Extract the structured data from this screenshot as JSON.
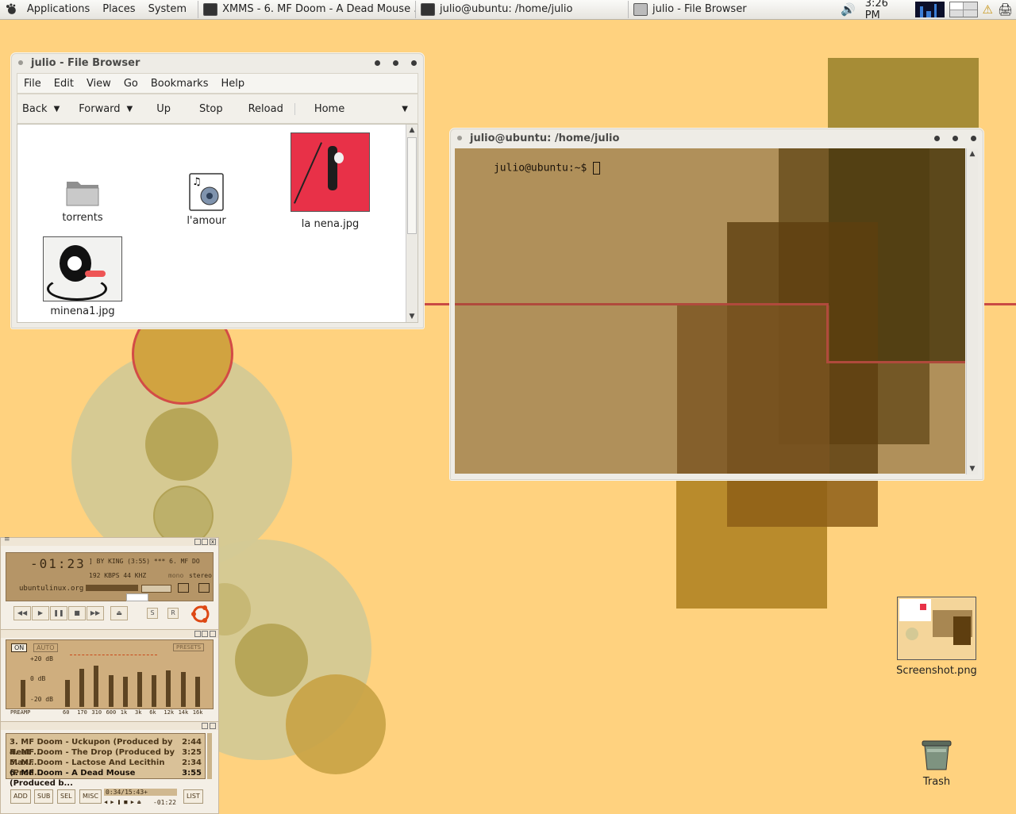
{
  "panel": {
    "menus": [
      "Applications",
      "Places",
      "System"
    ],
    "tasks": [
      {
        "label": "XMMS - 6. MF Doom - A Dead Mouse ..."
      },
      {
        "label": "julio@ubuntu: /home/julio"
      },
      {
        "label": "julio - File Browser"
      }
    ],
    "clock": "3:26 PM"
  },
  "file_browser": {
    "title": "julio - File Browser",
    "menus": [
      "File",
      "Edit",
      "View",
      "Go",
      "Bookmarks",
      "Help"
    ],
    "toolbar": {
      "back": "Back",
      "forward": "Forward",
      "up": "Up",
      "stop": "Stop",
      "reload": "Reload",
      "home": "Home"
    },
    "items": [
      {
        "name": "torrents",
        "icon": "folder-icon"
      },
      {
        "name": "l'amour",
        "icon": "audio-file-icon"
      },
      {
        "name": "la nena.jpg",
        "icon": "image-thumbnail"
      },
      {
        "name": "minena1.jpg",
        "icon": "image-thumbnail"
      }
    ]
  },
  "terminal": {
    "title": "julio@ubuntu: /home/julio",
    "prompt": "julio@ubuntu:~$ "
  },
  "xmms": {
    "time": "-01:23",
    "scroll_text": "] BY KING (3:55)  ***  6. MF DO",
    "bitrate": "192 KBPS 44 KHZ",
    "mono": "mono",
    "stereo": "stereo",
    "skin_text": "ubuntulinux.org",
    "eq": {
      "on": "ON",
      "auto": "AUTO",
      "presets": "PRESETS",
      "db_top": "+20 dB",
      "db_mid": "0 dB",
      "db_bottom": "-20 dB",
      "preamp": "PREAMP",
      "bands": [
        "60",
        "170",
        "310",
        "600",
        "1k",
        "3k",
        "6k",
        "12k",
        "14k",
        "16k"
      ]
    },
    "playlist": [
      {
        "title": "3. MF Doom - Uckupon (Produced by Heat ...",
        "time": "2:44"
      },
      {
        "title": "4. MF Doom - The Drop (Produced by Max...",
        "time": "3:25"
      },
      {
        "title": "5. MF Doom - Lactose And Lecithin (Prod...",
        "time": "2:34"
      },
      {
        "title": "6. MF Doom - A Dead Mouse (Produced b...",
        "time": "3:55"
      }
    ],
    "pl_buttons": {
      "add": "ADD",
      "sub": "SUB",
      "sel": "SEL",
      "misc": "MISC",
      "list": "LIST"
    },
    "pl_time": "0:34/15:43+",
    "pl_remaining": "-01:22"
  },
  "desktop": {
    "screenshot_label": "Screenshot.png",
    "trash_label": "Trash"
  }
}
